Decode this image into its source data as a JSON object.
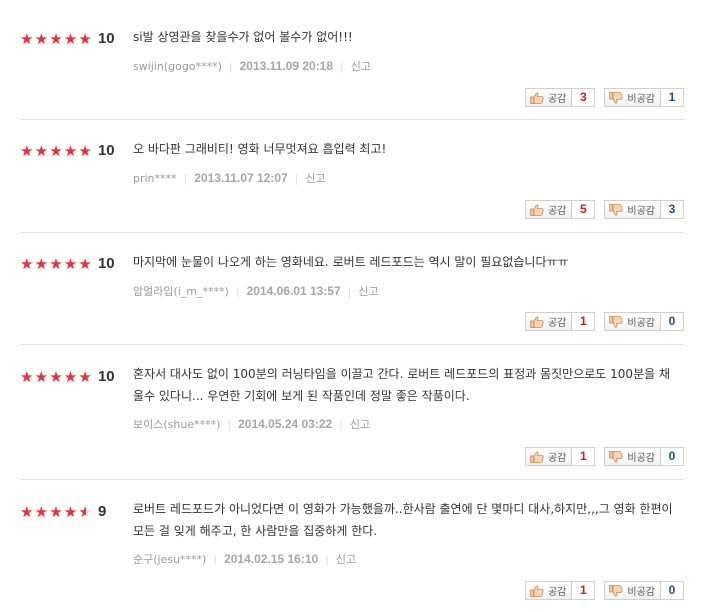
{
  "labels": {
    "like": "공감",
    "dislike": "비공감",
    "report": "신고"
  },
  "colors": {
    "star": "#e8313a",
    "like_count": "#d31a1a",
    "dislike_count": "#1f4d8f",
    "date": "#a6a6a6"
  },
  "reviews": [
    {
      "stars": 10,
      "score": "10",
      "text": "si발 상영관을 찾을수가 없어 볼수가 없어!!!",
      "user": "swijin(gogo****)",
      "date": "2013.11.09 20:18",
      "likes": "3",
      "dislikes": "1"
    },
    {
      "stars": 10,
      "score": "10",
      "text": "오 바다판 그래비티! 영화 너무멋져요 흡입력 최고!",
      "user": "prin****",
      "date": "2013.11.07 12:07",
      "likes": "5",
      "dislikes": "3"
    },
    {
      "stars": 10,
      "score": "10",
      "text": "마지막에 눈물이 나오게 하는 영화네요. 로버트 레드포드는 역시 말이 필요없습니다ㅠㅠ",
      "user": "암얼라입(i_m_****)",
      "date": "2014.06.01 13:57",
      "likes": "1",
      "dislikes": "0"
    },
    {
      "stars": 10,
      "score": "10",
      "text": "혼자서 대사도 없이 100분의 러닝타임을 이끌고 간다. 로버트 레드포드의 표정과 몸짓만으로도 100분을 채울수 있다니... 우연한 기회에 보게 된 작품인데 정말 좋은 작품이다.",
      "user": "보이스(shue****)",
      "date": "2014.05.24 03:22",
      "likes": "1",
      "dislikes": "0"
    },
    {
      "stars": 9,
      "score": "9",
      "text": "로버트 레드포드가 아니었다면 이 영화가 가능했을까..한사람 출연에 단 몇마디 대사,하지만,,,그 영화 한편이 모든 걸 잊게 해주고, 한 사람만을 집중하게 한다.",
      "user": "순구(jesu****)",
      "date": "2014.02.15 16:10",
      "likes": "1",
      "dislikes": "0"
    }
  ]
}
